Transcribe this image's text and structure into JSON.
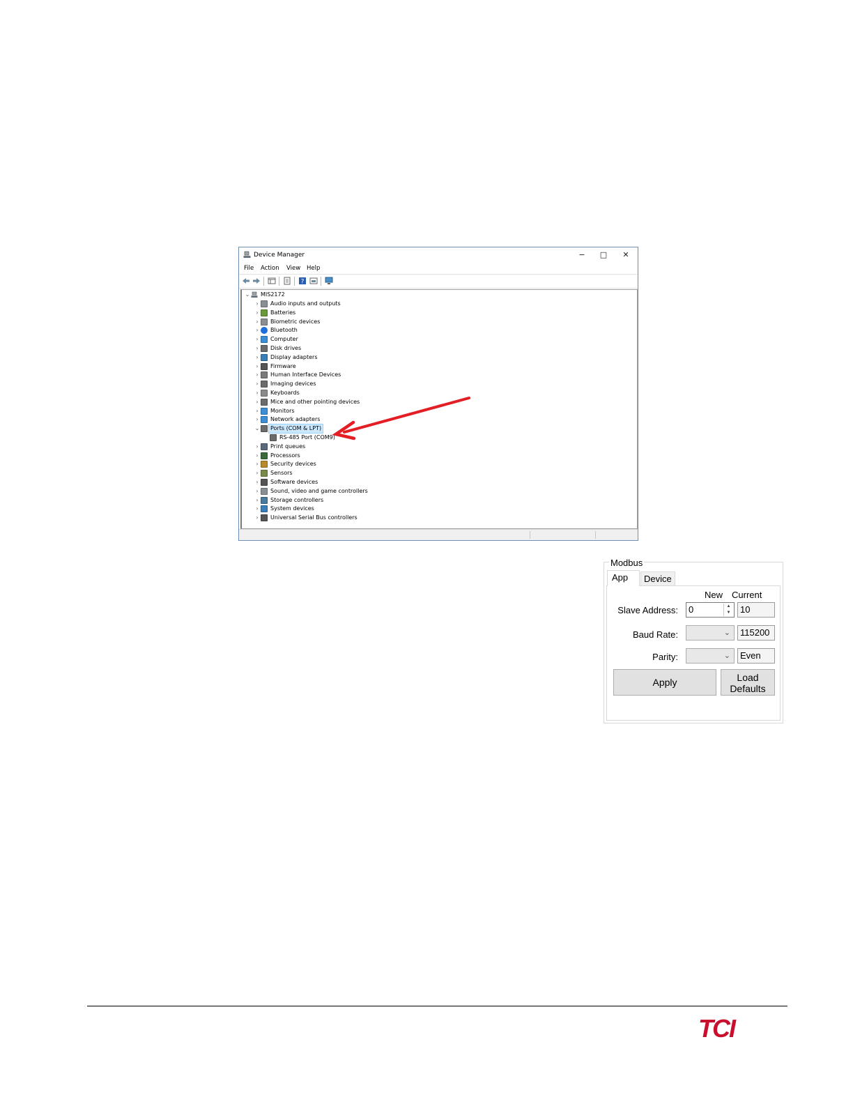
{
  "device_manager": {
    "title": "Device Manager",
    "window_controls": {
      "minimize": "−",
      "maximize": "□",
      "close": "✕"
    },
    "menu": [
      "File",
      "Action",
      "View",
      "Help"
    ],
    "tree": {
      "root": "MIS2172",
      "items": [
        {
          "label": "Audio inputs and outputs",
          "icon": "speaker-icon"
        },
        {
          "label": "Batteries",
          "icon": "battery-icon"
        },
        {
          "label": "Biometric devices",
          "icon": "fingerprint-icon"
        },
        {
          "label": "Bluetooth",
          "icon": "bluetooth-icon"
        },
        {
          "label": "Computer",
          "icon": "computer-icon"
        },
        {
          "label": "Disk drives",
          "icon": "disk-drive-icon"
        },
        {
          "label": "Display adapters",
          "icon": "display-adapter-icon"
        },
        {
          "label": "Firmware",
          "icon": "firmware-icon"
        },
        {
          "label": "Human Interface Devices",
          "icon": "hid-icon"
        },
        {
          "label": "Imaging devices",
          "icon": "camera-icon"
        },
        {
          "label": "Keyboards",
          "icon": "keyboard-icon"
        },
        {
          "label": "Mice and other pointing devices",
          "icon": "mouse-icon"
        },
        {
          "label": "Monitors",
          "icon": "monitor-icon"
        },
        {
          "label": "Network adapters",
          "icon": "network-adapter-icon"
        },
        {
          "label": "Ports (COM & LPT)",
          "icon": "port-icon",
          "expanded": true,
          "selected": true
        },
        {
          "label": "RS-485 Port (COM9)",
          "icon": "port-icon",
          "child": true
        },
        {
          "label": "Print queues",
          "icon": "printer-icon"
        },
        {
          "label": "Processors",
          "icon": "processor-icon"
        },
        {
          "label": "Security devices",
          "icon": "security-icon"
        },
        {
          "label": "Sensors",
          "icon": "sensor-icon"
        },
        {
          "label": "Software devices",
          "icon": "software-device-icon"
        },
        {
          "label": "Sound, video and game controllers",
          "icon": "sound-icon"
        },
        {
          "label": "Storage controllers",
          "icon": "storage-controller-icon"
        },
        {
          "label": "System devices",
          "icon": "system-devices-icon"
        },
        {
          "label": "Universal Serial Bus controllers",
          "icon": "usb-icon"
        }
      ]
    }
  },
  "modbus": {
    "group_label": "Modbus",
    "tabs": [
      "App",
      "Device"
    ],
    "headers": {
      "new": "New",
      "current": "Current"
    },
    "slave_address": {
      "label": "Slave Address:",
      "new": "0",
      "current": "10"
    },
    "baud_rate": {
      "label": "Baud Rate:",
      "new": "",
      "current": "115200"
    },
    "parity": {
      "label": "Parity:",
      "new": "",
      "current": "Even"
    },
    "apply_label": "Apply",
    "load_defaults_label": "Load Defaults"
  },
  "footer": {
    "logo_text": "TCI",
    "logo_color": "#c8102e"
  }
}
